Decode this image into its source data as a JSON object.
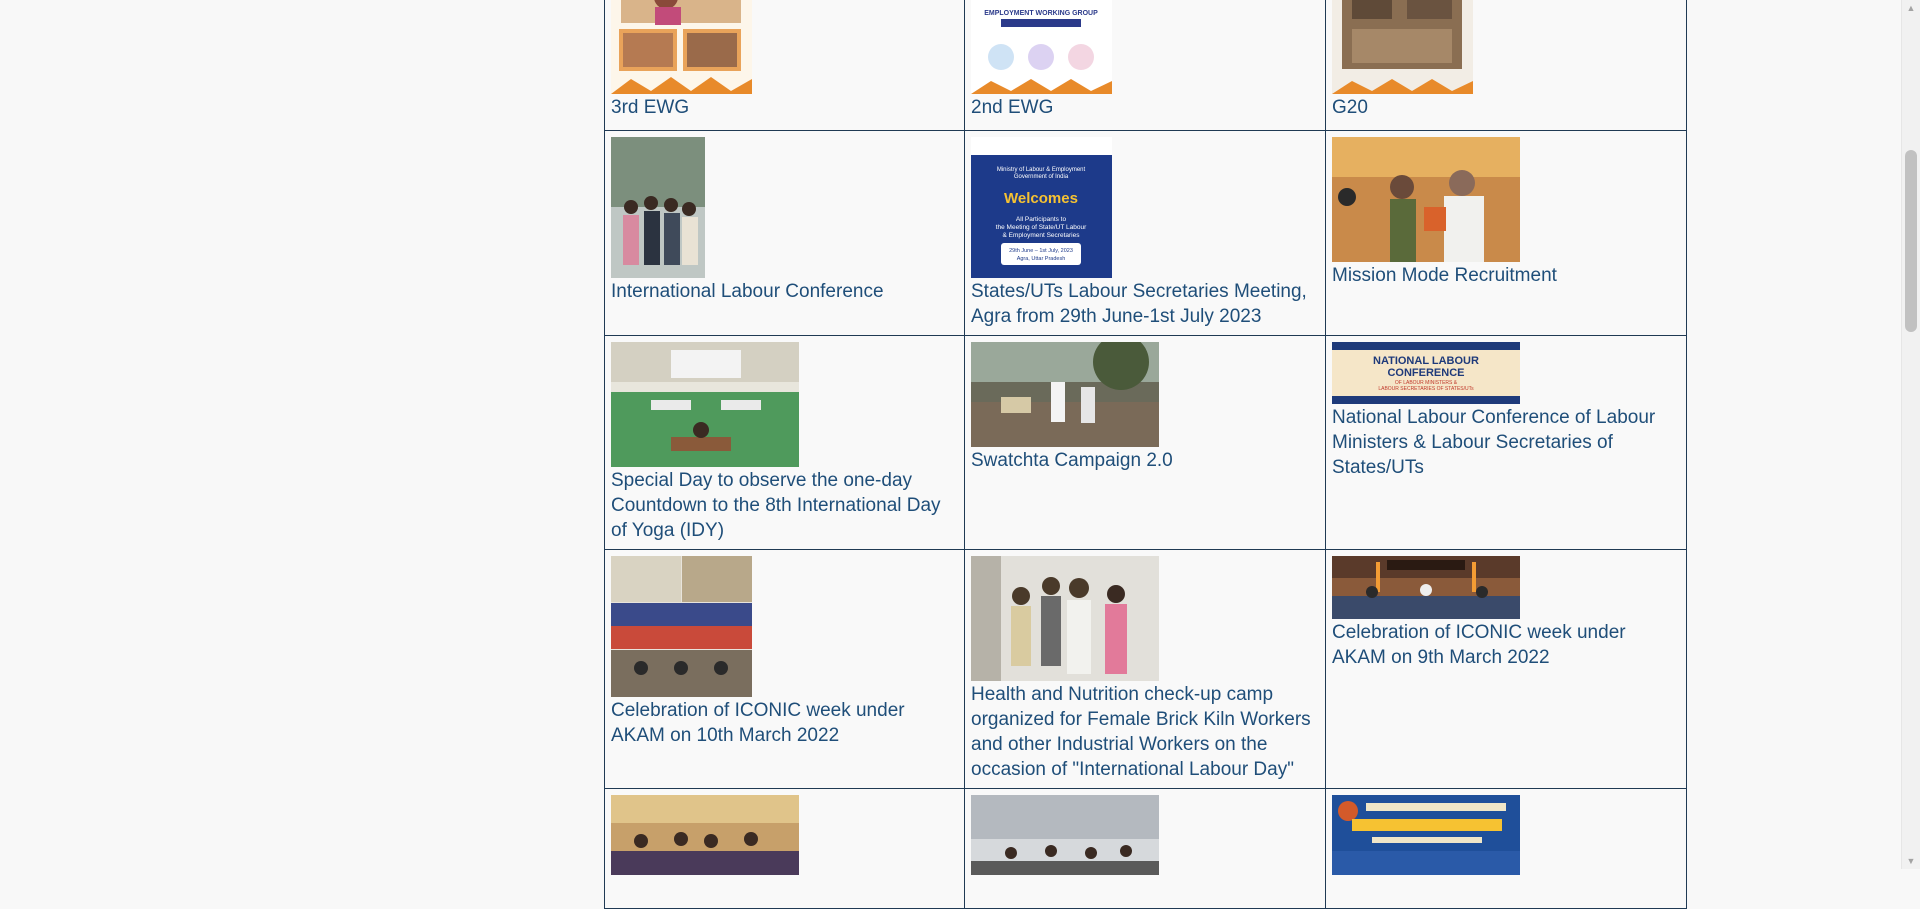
{
  "gallery": {
    "rows": [
      [
        {
          "caption": "3rd EWG"
        },
        {
          "caption": "2nd EWG",
          "image_text": [
            "EMPLOYMENT WORKING GROUP"
          ]
        },
        {
          "caption": "G20"
        }
      ],
      [
        {
          "caption": "International Labour Conference"
        },
        {
          "caption": "States/UTs Labour Secretaries Meeting, Agra from 29th June-1st July 2023",
          "image_text": [
            "Ministry of Labour & Employment",
            "Government of India",
            "Welcomes",
            "All Participants to",
            "the Meeting of State/UT Labour",
            "& Employment Secretaries",
            "29th June – 1st July, 2023",
            "Agra, Uttar Pradesh"
          ]
        },
        {
          "caption": "Mission Mode Recruitment"
        }
      ],
      [
        {
          "caption": "Special Day to observe the one-day Countdown to the 8th International Day of Yoga (IDY)"
        },
        {
          "caption": "Swatchta Campaign 2.0"
        },
        {
          "caption": "National Labour Conference of Labour Ministers & Labour Secretaries of States/UTs",
          "image_text": [
            "NATIONAL LABOUR",
            "CONFERENCE",
            "OF LABOUR MINISTERS &",
            "LABOUR SECRETARIES OF STATES/UTs"
          ]
        }
      ],
      [
        {
          "caption": "Celebration of ICONIC week under AKAM on 10th March 2022"
        },
        {
          "caption": "Health and Nutrition check-up camp organized for Female Brick Kiln Workers and other Industrial Workers on the occasion of \"International Labour Day\""
        },
        {
          "caption": "Celebration of ICONIC week under AKAM on 9th March 2022"
        }
      ],
      [
        {
          "caption": ""
        },
        {
          "caption": ""
        },
        {
          "caption": ""
        }
      ]
    ]
  },
  "colors": {
    "border": "#203a54",
    "link": "#1f4e79",
    "background": "#f8f8f8"
  }
}
